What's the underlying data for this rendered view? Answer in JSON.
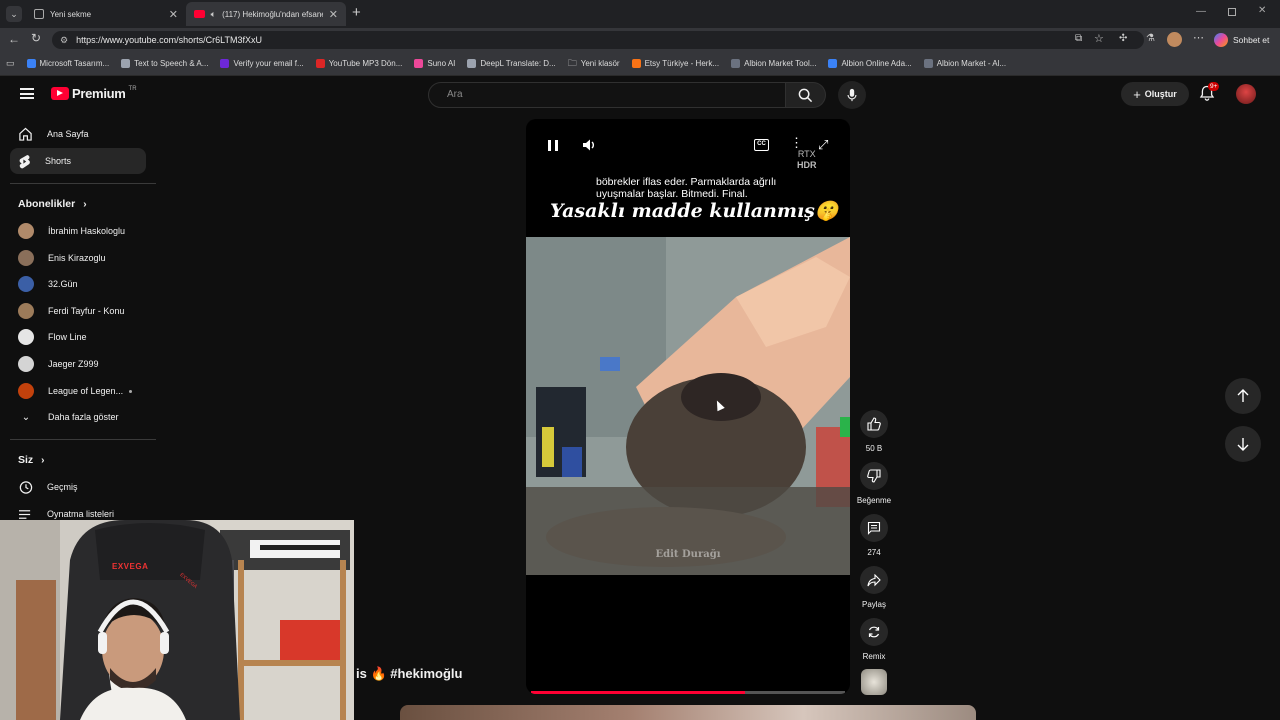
{
  "browser": {
    "tabs": [
      {
        "title": "Yeni sekme"
      },
      {
        "title": "(117) Hekimoğlu'ndan efsane"
      }
    ],
    "url": "https://www.youtube.com/shorts/Cr6LTM3fXxU",
    "profile_button": "Sohbet et",
    "bookmarks": [
      {
        "label": "Microsoft Tasarım...",
        "color": "#3b82f6"
      },
      {
        "label": "Text to Speech & A...",
        "color": "#9ca3af"
      },
      {
        "label": "Verify your email f...",
        "color": "#6d28d9"
      },
      {
        "label": "YouTube MP3 Dön...",
        "color": "#dc2626"
      },
      {
        "label": "Suno AI",
        "color": "#ec4899"
      },
      {
        "label": "DeepL Translate: D...",
        "color": "#9ca3af"
      },
      {
        "label": "Yeni klasör",
        "color": "#9ca3af"
      },
      {
        "label": "Etsy Türkiye - Herk...",
        "color": "#f97316"
      },
      {
        "label": "Albion Market Tool...",
        "color": "#6b7280"
      },
      {
        "label": "Albion Online Ada...",
        "color": "#3b82f6"
      },
      {
        "label": "Albion Market - Al...",
        "color": "#6b7280"
      }
    ]
  },
  "yt": {
    "logo_text": "Premium",
    "logo_region": "TR",
    "search_placeholder": "Ara",
    "create_label": "Oluştur",
    "notif_count": "9+",
    "accent": "#ff0033"
  },
  "sidebar": {
    "home": "Ana Sayfa",
    "shorts": "Shorts",
    "subs_heading": "Abonelikler",
    "subscriptions": [
      {
        "name": "İbrahim Haskologlu",
        "color": "#b08a6a"
      },
      {
        "name": "Enis Kirazoglu",
        "color": "#8a6f5a"
      },
      {
        "name": "32.Gün",
        "color": "#3b5fa6"
      },
      {
        "name": "Ferdi Tayfur - Konu",
        "color": "#9c7b5a"
      },
      {
        "name": "Flow Line",
        "color": "#e5e5e5"
      },
      {
        "name": "Jaeger Z999",
        "color": "#d4d4d4"
      },
      {
        "name": "League of Legen...",
        "color": "#c2410c"
      }
    ],
    "show_more": "Daha fazla göster",
    "you_heading": "Siz",
    "history": "Geçmiş",
    "playlists": "Oynatma listeleri"
  },
  "player": {
    "caption_small": "böbrekler iflas eder. Parmaklarda ağrılı uyuşmalar başlar. Bitmedi. Final.",
    "caption_big": "Yasaklı madde kullanmış",
    "emoji": "🤫",
    "badge_line1": "RTX",
    "badge_line2": "HDR",
    "watermark": "Edit Durağı",
    "progress": 0.68
  },
  "actions": {
    "likes": "50 B",
    "dislike": "Beğenme",
    "comments": "274",
    "share": "Paylaş",
    "remix": "Remix"
  },
  "video_title_partial": "is 🔥 #hekimoğlu",
  "webcam": {
    "chair_brand": "EXVEGA",
    "chair_brand_small": "EXVEGA"
  }
}
